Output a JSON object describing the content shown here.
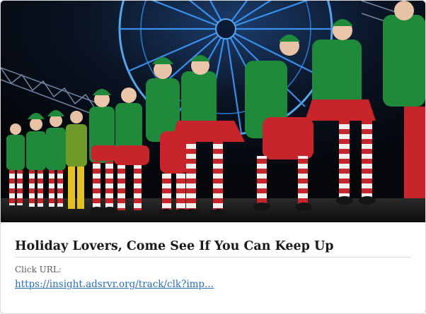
{
  "ad": {
    "image_alt": "",
    "headline": "Holiday Lovers, Come See If You Can Keep Up",
    "click_url_label": "Click URL:",
    "click_url": "https://insight.adsrvr.org/track/clk?imp..."
  },
  "colors": {
    "link": "#2a6db5",
    "headline": "#1a1a1a",
    "label": "#5a5a5a",
    "card_border": "#d9d9d9",
    "elf_green": "#1f8a3a",
    "elf_red": "#c8242c",
    "night_sky": "#05070c"
  }
}
